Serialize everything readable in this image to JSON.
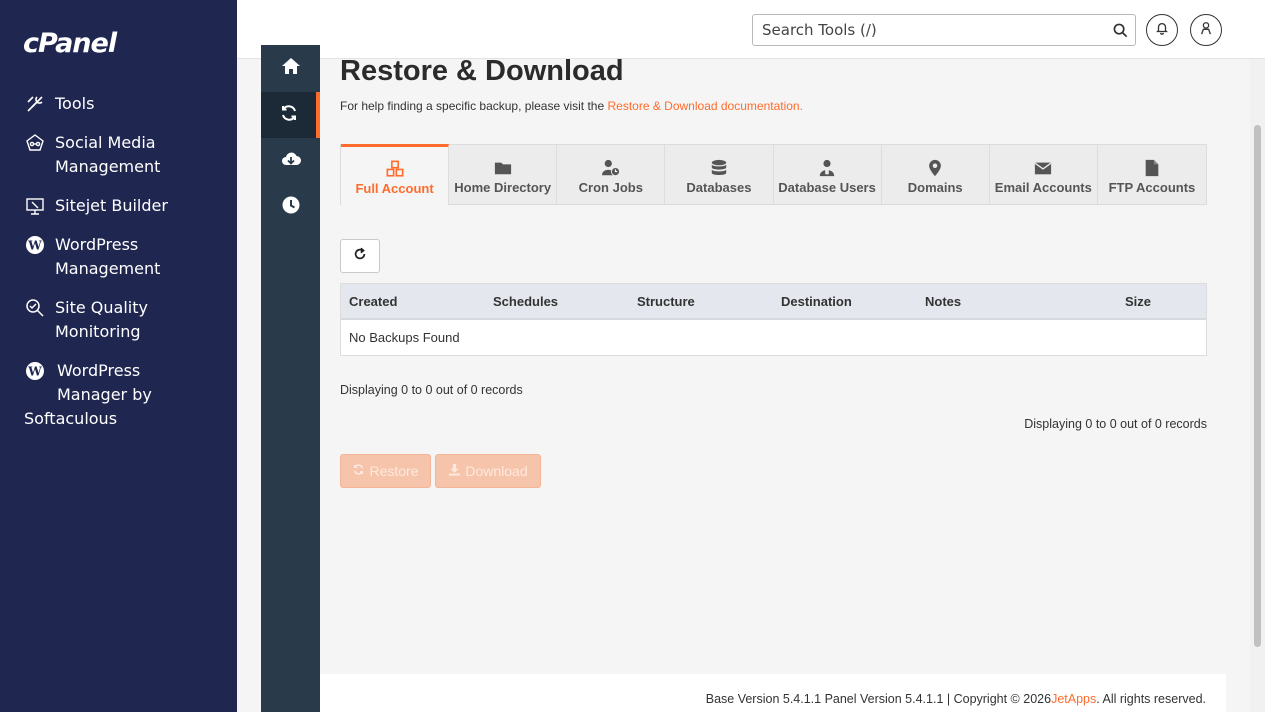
{
  "brand": {
    "logo_text": "cPanel"
  },
  "sidebar": {
    "items": [
      {
        "icon": "tools-icon",
        "label": "Tools"
      },
      {
        "icon": "social-media-icon",
        "label_line1": "Social Media",
        "label_line2": "Management"
      },
      {
        "icon": "sitejet-icon",
        "label": "Sitejet Builder"
      },
      {
        "icon": "wordpress-icon",
        "label_line1": "WordPress",
        "label_line2": "Management"
      },
      {
        "icon": "site-quality-icon",
        "label_line1": "Site Quality",
        "label_line2": "Monitoring"
      },
      {
        "icon": "wordpress-icon",
        "label_line1": "WordPress",
        "label_line2": "Manager by",
        "label_line3": "Softaculous"
      }
    ]
  },
  "header": {
    "search_placeholder": "Search Tools (/)",
    "search_icon": "search-icon",
    "notifications_icon": "bell-icon",
    "user_icon": "user-icon"
  },
  "rail": {
    "items": [
      {
        "icon": "home-icon"
      },
      {
        "icon": "restore-icon",
        "active": true
      },
      {
        "icon": "cloud-download-icon"
      },
      {
        "icon": "clock-icon"
      }
    ]
  },
  "page": {
    "title": "Restore & Download",
    "help_prefix": "For help finding a specific backup, please visit the ",
    "help_link": "Restore & Download documentation."
  },
  "tabs": [
    {
      "label": "Full Account",
      "icon": "cubes-icon",
      "active": true
    },
    {
      "label": "Home Directory",
      "icon": "folder-icon"
    },
    {
      "label": "Cron Jobs",
      "icon": "cron-user-icon"
    },
    {
      "label": "Databases",
      "icon": "database-icon"
    },
    {
      "label": "Database Users",
      "icon": "db-user-icon"
    },
    {
      "label": "Domains",
      "icon": "map-marker-icon"
    },
    {
      "label": "Email Accounts",
      "icon": "envelope-icon"
    },
    {
      "label": "FTP Accounts",
      "icon": "file-icon"
    }
  ],
  "table": {
    "columns": [
      "Created",
      "Schedules",
      "Structure",
      "Destination",
      "Notes",
      "Size"
    ],
    "empty_message": "No Backups Found"
  },
  "records": {
    "top": "Displaying 0 to 0 out of 0 records",
    "bottom": "Displaying 0 to 0 out of 0 records"
  },
  "actions": {
    "restore_label": "Restore",
    "download_label": "Download"
  },
  "footer": {
    "prefix": "Base Version 5.4.1.1 Panel Version 5.4.1.1 | Copyright © 2026 ",
    "link": "JetApps",
    "suffix": ". All rights reserved."
  },
  "colors": {
    "sidebar_bg": "#1f2650",
    "rail_bg": "#293a4a",
    "accent": "#ff6c2c"
  }
}
